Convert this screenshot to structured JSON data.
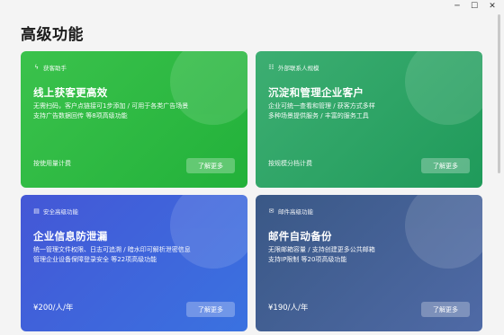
{
  "window": {
    "controls": {
      "minimize": "─",
      "maximize": "☐",
      "close": "✕"
    }
  },
  "page": {
    "title": "高级功能"
  },
  "cards": [
    {
      "tag": "获客助手",
      "tag_icon": "lightning-icon",
      "title": "线上获客更高效",
      "desc_lines": [
        "无需扫码，客户点链接可1步添加 / 可用于各类广告场景",
        "支持广告数据回传 等8项高级功能"
      ],
      "footer": "按使用量计费",
      "button": "了解更多",
      "color": "#2db843"
    },
    {
      "tag": "外部联系人规模",
      "tag_icon": "contacts-icon",
      "title": "沉淀和管理企业客户",
      "desc_lines": [
        "企业可统一查看和管理 / 获客方式多样",
        "多种场景提供服务 / 丰富的服务工具"
      ],
      "footer": "按规模分档计费",
      "button": "了解更多",
      "color": "#28a365"
    },
    {
      "tag": "安全高级功能",
      "tag_icon": "shield-icon",
      "title": "企业信息防泄漏",
      "desc_lines": [
        "统一管理文件权限、日志可追溯 / 暗水印可解析泄密信息",
        "管理企业设备保障登录安全 等22项高级功能"
      ],
      "price": "¥200/人/年",
      "button": "了解更多",
      "color": "#3f63dc"
    },
    {
      "tag": "邮件高级功能",
      "tag_icon": "mail-icon",
      "title": "邮件自动备份",
      "desc_lines": [
        "无限邮箱容量 / 支持创建更多公共邮箱",
        "支持IP限制 等20项高级功能"
      ],
      "price": "¥190/人/年",
      "button": "了解更多",
      "color": "#42608f"
    }
  ]
}
